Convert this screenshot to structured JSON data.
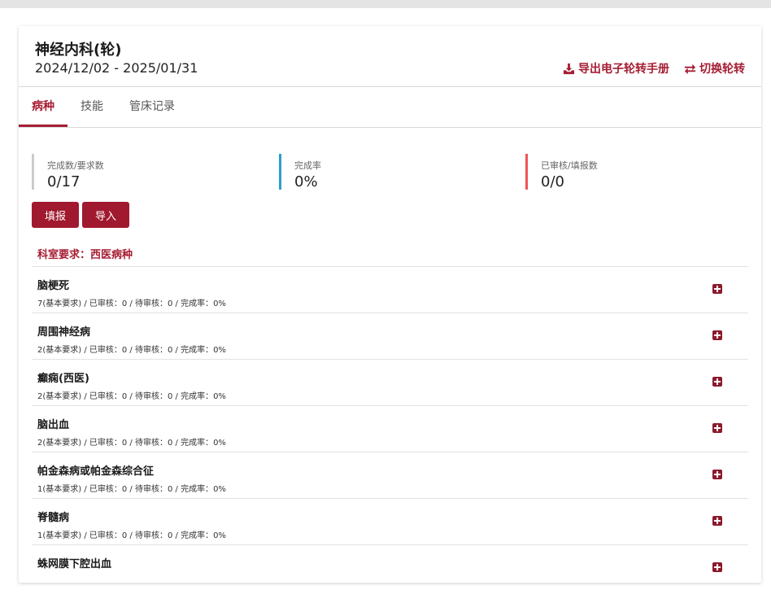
{
  "header": {
    "title": "神经内科(轮)",
    "date_range": "2024/12/02 - 2025/01/31",
    "actions": [
      {
        "label": "导出电子轮转手册",
        "icon": "download-icon"
      },
      {
        "label": "切换轮转",
        "icon": "switch-icon"
      }
    ]
  },
  "tabs": [
    {
      "label": "病种",
      "active": true
    },
    {
      "label": "技能",
      "active": false
    },
    {
      "label": "管床记录",
      "active": false
    }
  ],
  "stats": [
    {
      "label": "完成数/要求数",
      "value": "0/17",
      "color": "#c8ccd0"
    },
    {
      "label": "完成率",
      "value": "0%",
      "color": "#2a9fd0"
    },
    {
      "label": "已审核/填报数",
      "value": "0/0",
      "color": "#ef5454"
    }
  ],
  "buttons": {
    "fill": "填报",
    "import": "导入"
  },
  "section": {
    "title": "科室要求：西医病种"
  },
  "diseases": [
    {
      "name": "脑梗死",
      "detail": "7(基本要求) / 已审核：0 / 待审核：0 / 完成率：0%"
    },
    {
      "name": "周围神经病",
      "detail": "2(基本要求) / 已审核：0 / 待审核：0 / 完成率：0%"
    },
    {
      "name": "癫痫(西医)",
      "detail": "2(基本要求) / 已审核：0 / 待审核：0 / 完成率：0%"
    },
    {
      "name": "脑出血",
      "detail": "2(基本要求) / 已审核：0 / 待审核：0 / 完成率：0%"
    },
    {
      "name": "帕金森病或帕金森综合征",
      "detail": "1(基本要求) / 已审核：0 / 待审核：0 / 完成率：0%"
    },
    {
      "name": "脊髓病",
      "detail": "1(基本要求) / 已审核：0 / 待审核：0 / 完成率：0%"
    },
    {
      "name": "蛛网膜下腔出血",
      "detail": ""
    }
  ],
  "colors": {
    "accent": "#a61d33",
    "button": "#a0192f"
  }
}
